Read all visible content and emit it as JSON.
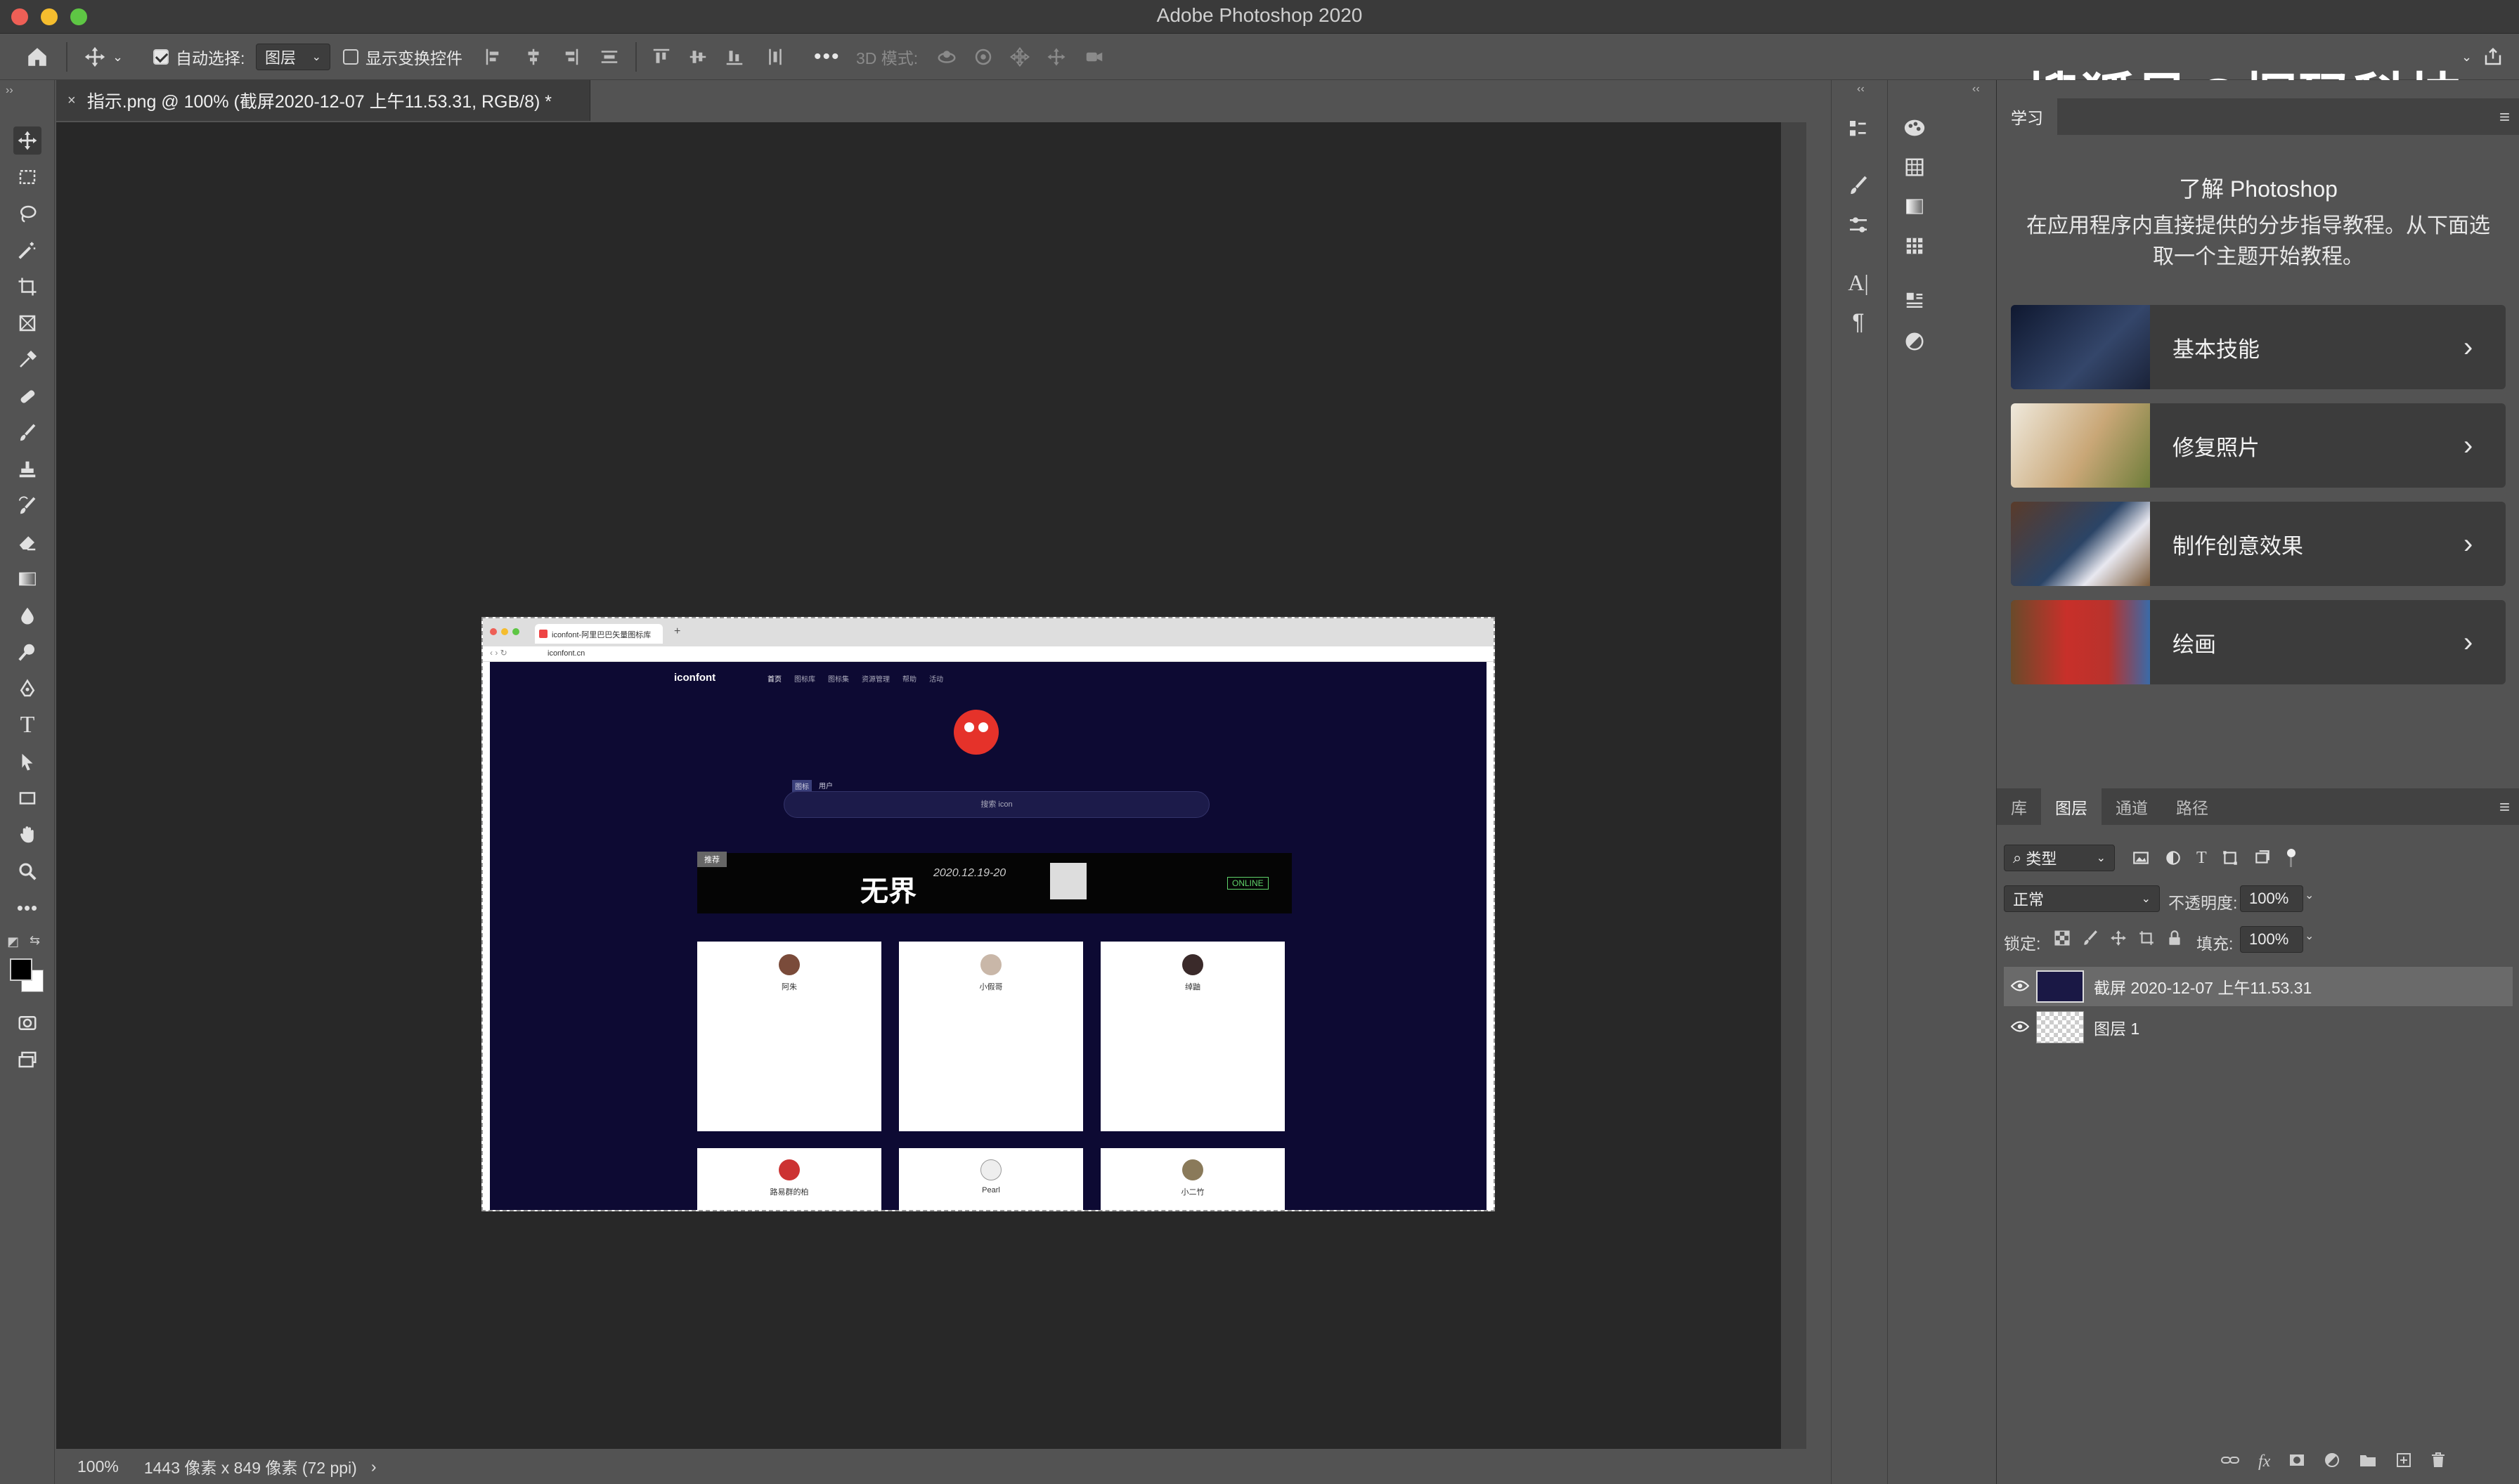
{
  "window": {
    "title": "Adobe Photoshop 2020"
  },
  "watermark": "搜狐号@探码科技",
  "options_bar": {
    "auto_select_label": "自动选择:",
    "auto_select_checked": true,
    "auto_select_target": "图层",
    "show_transform_label": "显示变换控件",
    "show_transform_checked": false,
    "mode_3d_label": "3D 模式:"
  },
  "document": {
    "tab_title": "指示.png @ 100% (截屏2020-12-07 上午11.53.31, RGB/8) *",
    "zoom": "100%",
    "doc_info": "1443 像素 x 849 像素 (72 ppi)"
  },
  "embedded_screenshot": {
    "browser_tab": "iconfont-阿里巴巴矢量图标库",
    "url": "iconfont.cn",
    "logo": "iconfont",
    "nav": [
      "首页",
      "图标库",
      "图标集",
      "资源管理",
      "帮助",
      "活动"
    ],
    "search_tabs": [
      "图标",
      "用户"
    ],
    "search_placeholder": "搜索 icon",
    "banner_tag": "推荐",
    "banner_title": "无界",
    "banner_date": "2020.12.19-20",
    "banner_online": "ONLINE",
    "cards": [
      {
        "name": "阿朱"
      },
      {
        "name": "小假哥"
      },
      {
        "name": "绰鼬"
      }
    ],
    "cards_row2": [
      {
        "name": "路易群的柏"
      },
      {
        "name": "Pearl"
      },
      {
        "name": "小二竹"
      }
    ]
  },
  "learn_panel": {
    "tab": "学习",
    "title": "了解 Photoshop",
    "description": "在应用程序内直接提供的分步指导教程。从下面选取一个主题开始教程。",
    "topics": [
      {
        "label": "基本技能",
        "thumb_color": "#1f2a44"
      },
      {
        "label": "修复照片",
        "thumb_color": "#cfc1a5"
      },
      {
        "label": "制作创意效果",
        "thumb_color": "#2b4466"
      },
      {
        "label": "绘画",
        "thumb_color": "#b8322c"
      }
    ]
  },
  "layers_panel": {
    "tabs": [
      "库",
      "图层",
      "通道",
      "路径"
    ],
    "active_tab": "图层",
    "filter_kind": "类型",
    "blend_mode": "正常",
    "opacity_label": "不透明度:",
    "opacity_value": "100%",
    "lock_label": "锁定:",
    "fill_label": "填充:",
    "fill_value": "100%",
    "layers": [
      {
        "name": "截屏 2020-12-07 上午11.53.31",
        "selected": true,
        "visible": true
      },
      {
        "name": "图层 1",
        "selected": false,
        "visible": true
      }
    ]
  }
}
